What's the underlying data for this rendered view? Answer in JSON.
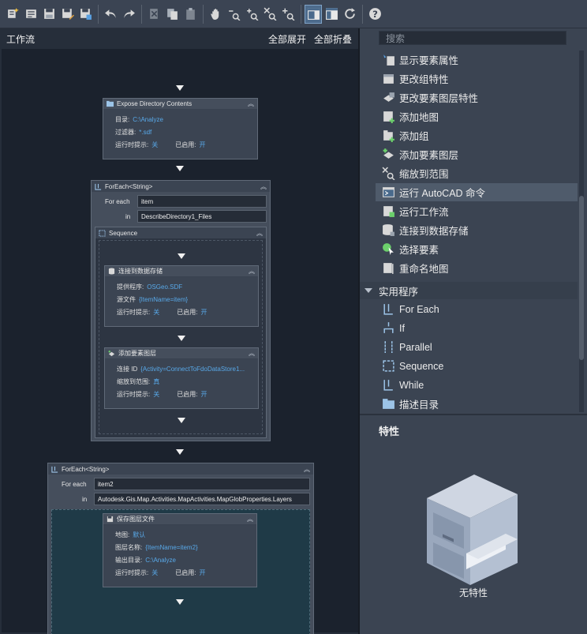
{
  "toolbar": {
    "buttons": [
      "new-workflow-icon",
      "open-workflow-icon",
      "save-icon",
      "save-as-icon",
      "export-icon",
      "undo-icon",
      "redo-icon",
      "cut-icon",
      "copy-icon",
      "paste-icon",
      "pan-icon",
      "zoom-out-icon",
      "zoom-in-icon",
      "zoom-extents-icon",
      "zoom-window-icon",
      "layout-horizontal-icon",
      "layout-vertical-icon",
      "refresh-icon",
      "help-icon"
    ]
  },
  "workflow": {
    "title": "工作流",
    "expand_all": "全部展开",
    "collapse_all": "全部折叠",
    "expose": {
      "name": "Expose Directory Contents",
      "dir_label": "目录:",
      "dir_value": "C:\\Analyze",
      "filter_label": "过滤器:",
      "filter_value": "*.sdf",
      "prompt_label": "运行时提示:",
      "prompt_value": "关",
      "enabled_label": "已启用:",
      "enabled_value": "开"
    },
    "foreach1": {
      "name": "ForEach<String>",
      "for_each_label": "For each",
      "for_each_value": "item",
      "in_label": "in",
      "in_value": "DescribeDirectory1_Files",
      "sequence_name": "Sequence",
      "connect": {
        "name": "连接到数据存储",
        "provider_label": "提供程序:",
        "provider_value": "OSGeo.SDF",
        "source_label": "源文件",
        "source_value": "{ItemName=item}",
        "prompt_label": "运行时提示:",
        "prompt_value": "关",
        "enabled_label": "已启用:",
        "enabled_value": "开"
      },
      "addlayer": {
        "name": "添加要素图层",
        "conn_label": "连接 ID",
        "conn_value": "{Activity=ConnectToFdoDataStore1...",
        "zoom_label": "缩放到范围:",
        "zoom_value": "真",
        "prompt_label": "运行时提示:",
        "prompt_value": "关",
        "enabled_label": "已启用:",
        "enabled_value": "开"
      }
    },
    "foreach2": {
      "name": "ForEach<String>",
      "for_each_label": "For each",
      "for_each_value": "item2",
      "in_label": "in",
      "in_value": "Autodesk.Gis.Map.Activities.MapActivities.MapGlobProperties.Layers",
      "save": {
        "name": "保存图层文件",
        "map_label": "地图:",
        "map_value": "默认",
        "layer_label": "图层名称:",
        "layer_value": "{ItemName=item2}",
        "out_label": "输出目录:",
        "out_value": "C:\\Analyze",
        "prompt_label": "运行时提示:",
        "prompt_value": "关",
        "enabled_label": "已启用:",
        "enabled_value": "开"
      }
    }
  },
  "palette": {
    "search_placeholder": "搜索",
    "items": [
      "显示要素属性",
      "更改组特性",
      "更改要素图层特性",
      "添加地图",
      "添加组",
      "添加要素图层",
      "缩放到范围",
      "运行 AutoCAD 命令",
      "运行工作流",
      "连接到数据存储",
      "选择要素",
      "重命名地图"
    ],
    "group_title": "实用程序",
    "utilities": [
      "For Each",
      "If",
      "Parallel",
      "Sequence",
      "While",
      "描述目录"
    ],
    "properties_title": "特性",
    "no_properties": "无特性"
  },
  "colors": {
    "accent": "#58a8e8",
    "selected": "#4f5b6b"
  }
}
